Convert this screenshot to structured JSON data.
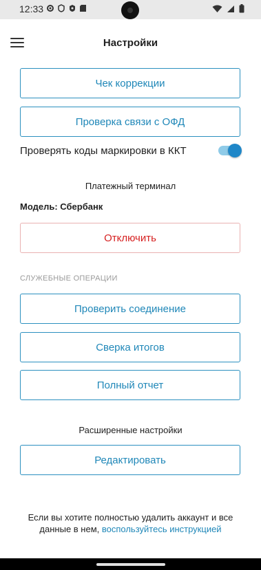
{
  "status_bar": {
    "time": "12:33",
    "left_icons": [
      "settings-gear-icon",
      "vpn-key-icon",
      "shield-icon",
      "sd-card-icon"
    ],
    "right_icons": [
      "wifi-icon",
      "cellular-signal-icon",
      "battery-icon"
    ]
  },
  "header": {
    "title": "Настройки",
    "menu_icon": "hamburger-menu-icon"
  },
  "buttons": {
    "correction_receipt": "Чек коррекции",
    "ofd_check": "Проверка связи с ОФД"
  },
  "marking_toggle": {
    "label": "Проверять коды маркировки в ККТ",
    "enabled": true
  },
  "payment_terminal": {
    "heading": "Платежный терминал",
    "model_text": "Модель: Сбербанк",
    "disconnect_label": "Отключить"
  },
  "service_operations": {
    "caption": "СЛУЖЕБНЫЕ ОПЕРАЦИИ",
    "check_connection_label": "Проверить соединение",
    "reconciliation_label": "Сверка итогов",
    "full_report_label": "Полный отчет"
  },
  "advanced_settings": {
    "heading": "Расширенные настройки",
    "edit_label": "Редактировать"
  },
  "footer": {
    "text": "Если вы хотите полностью удалить аккаунт и все данные в нем, ",
    "link": "воспользуйтесь инструкцией"
  },
  "colors": {
    "accent": "#1f87b8",
    "danger": "#d61f1f",
    "danger_border": "#e9b1b1",
    "toggle_on": "#1f87c8"
  }
}
